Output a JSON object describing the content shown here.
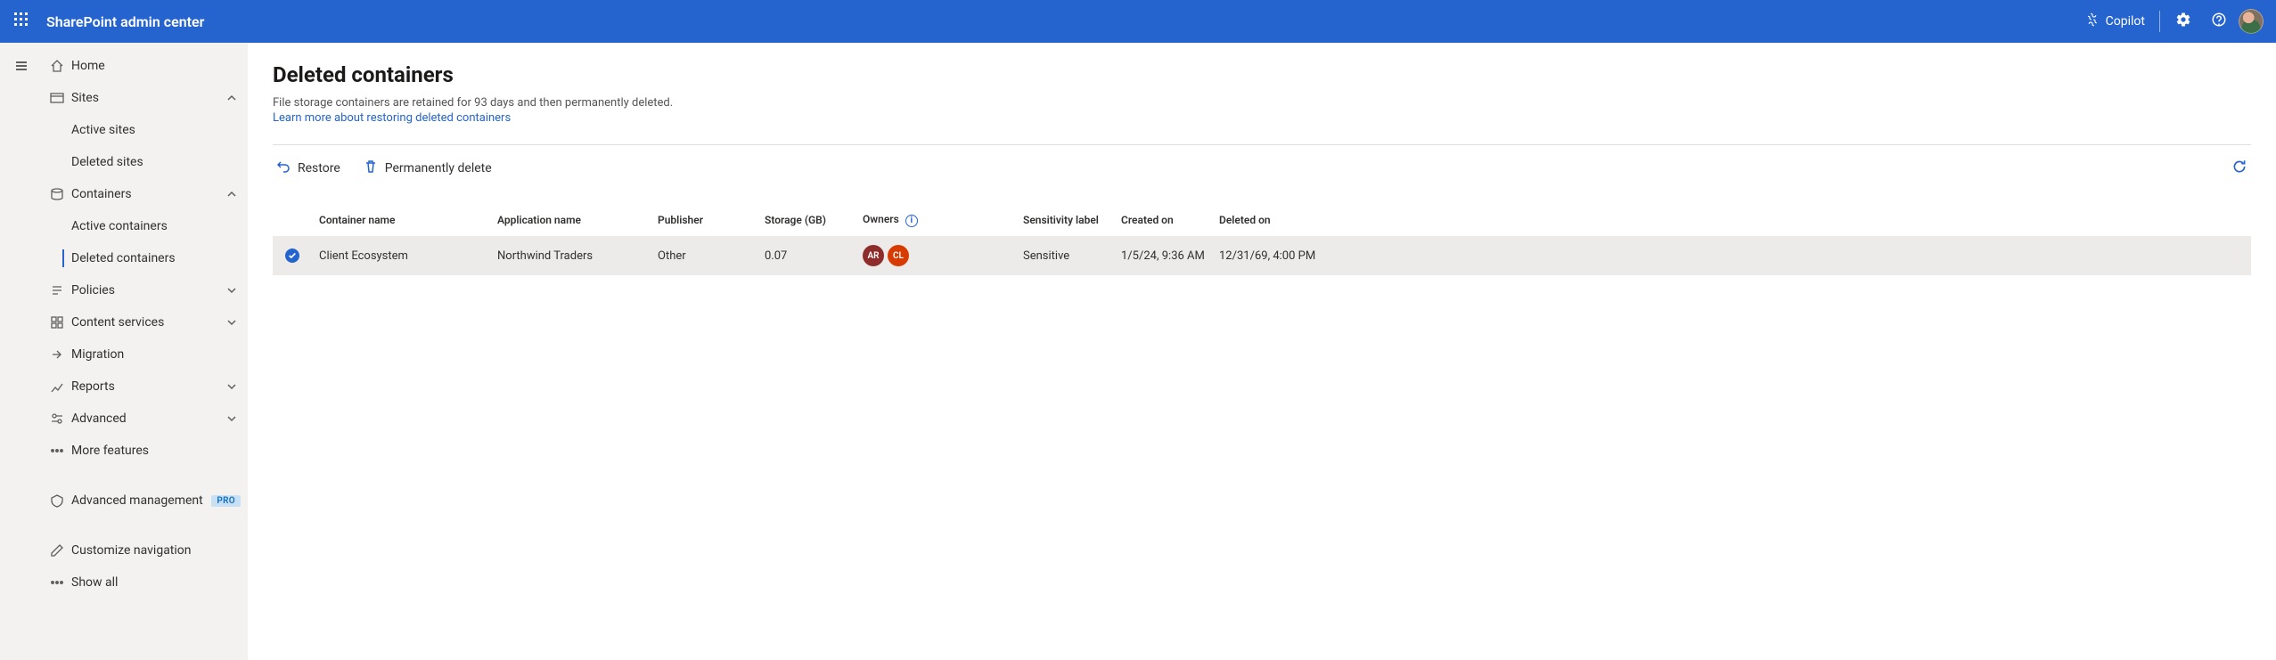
{
  "header": {
    "title": "SharePoint admin center",
    "copilot_label": "Copilot"
  },
  "nav": {
    "home": "Home",
    "sites": "Sites",
    "active_sites": "Active sites",
    "deleted_sites": "Deleted sites",
    "containers": "Containers",
    "active_containers": "Active containers",
    "deleted_containers": "Deleted containers",
    "policies": "Policies",
    "content_services": "Content services",
    "migration": "Migration",
    "reports": "Reports",
    "advanced": "Advanced",
    "more_features": "More features",
    "advanced_management": "Advanced management",
    "pro_badge": "PRO",
    "customize_nav": "Customize navigation",
    "show_all": "Show all"
  },
  "page": {
    "title": "Deleted containers",
    "description": "File storage containers are retained for 93 days and then permanently deleted.",
    "learn_link": "Learn more about restoring deleted containers"
  },
  "commands": {
    "restore": "Restore",
    "perm_delete": "Permanently delete"
  },
  "table": {
    "cols": {
      "container_name": "Container name",
      "application_name": "Application name",
      "publisher": "Publisher",
      "storage": "Storage (GB)",
      "owners": "Owners",
      "sensitivity": "Sensitivity label",
      "created_on": "Created on",
      "deleted_on": "Deleted on"
    },
    "rows": [
      {
        "container_name": "Client Ecosystem",
        "application_name": "Northwind Traders",
        "publisher": "Other",
        "storage": "0.07",
        "owners": [
          {
            "initials": "AR",
            "color": "#8e2c2c"
          },
          {
            "initials": "CL",
            "color": "#d83b01"
          }
        ],
        "sensitivity": "Sensitive",
        "created_on": "1/5/24, 9:36 AM",
        "deleted_on": "12/31/69, 4:00 PM"
      }
    ]
  }
}
